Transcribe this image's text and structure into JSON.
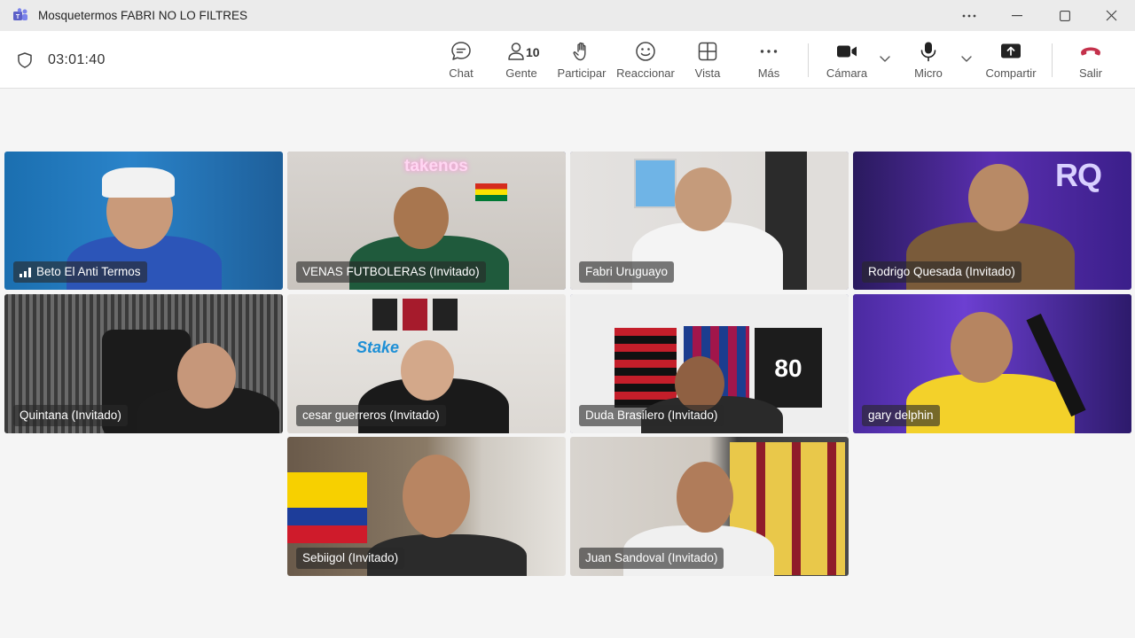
{
  "window": {
    "title": "Mosquetermos FABRI NO LO FILTRES"
  },
  "meeting": {
    "timer": "03:01:40",
    "people_count": "10"
  },
  "toolbar": {
    "chat": "Chat",
    "people": "Gente",
    "raise_hand": "Participar",
    "react": "Reaccionar",
    "view": "Vista",
    "more": "Más",
    "camera": "Cámara",
    "mic": "Micro",
    "share": "Compartir",
    "leave": "Salir"
  },
  "colors": {
    "accent": "#6264a7",
    "leave": "#c4314b"
  },
  "participants": [
    {
      "name": "Beto El Anti Termos",
      "active": false,
      "icon": "signal-icon"
    },
    {
      "name": "VENAS FUTBOLERAS (Invitado)",
      "active": true,
      "sign": "takenos"
    },
    {
      "name": "Fabri Uruguayo",
      "active": true
    },
    {
      "name": "Rodrigo Quesada (Invitado)",
      "active": false,
      "sign": "RQ"
    },
    {
      "name": "Quintana (Invitado)",
      "active": false
    },
    {
      "name": "cesar guerreros (Invitado)",
      "active": false,
      "sign": "Stake"
    },
    {
      "name": "Duda Brasilero (Invitado)",
      "active": true,
      "sign": "80"
    },
    {
      "name": "gary delphin",
      "active": true
    },
    {
      "name": "Sebiigol (Invitado)",
      "active": false
    },
    {
      "name": "Juan Sandoval (Invitado)",
      "active": false
    }
  ]
}
